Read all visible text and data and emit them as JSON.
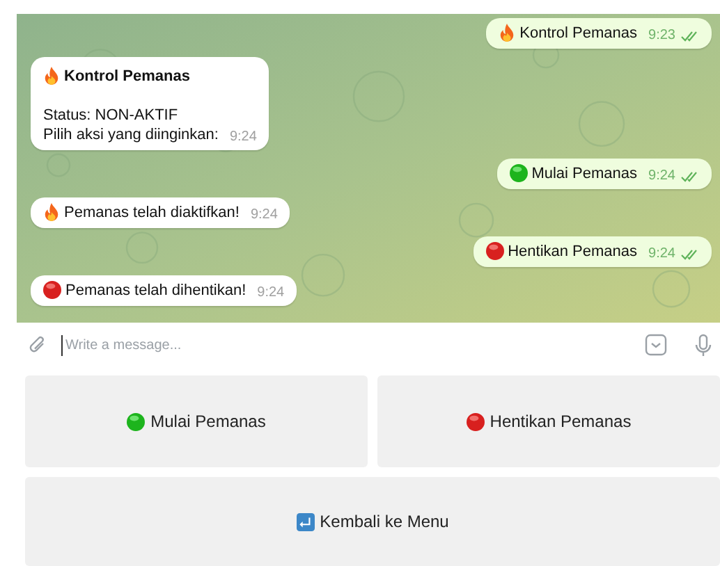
{
  "messages": [
    {
      "outgoing": true,
      "emoji": {
        "kind": "fire"
      },
      "lines": [
        "Kontrol Pemanas"
      ],
      "time": "9:23",
      "read": true
    },
    {
      "outgoing": false,
      "emoji": {
        "kind": "fire"
      },
      "title": "Kontrol Pemanas",
      "lines": [
        "Status: NON-AKTIF",
        "Pilih aksi yang diinginkan:"
      ],
      "time": "9:24"
    },
    {
      "outgoing": true,
      "emoji": {
        "kind": "go"
      },
      "lines": [
        "Mulai Pemanas"
      ],
      "time": "9:24",
      "read": true
    },
    {
      "outgoing": false,
      "emoji": {
        "kind": "fire"
      },
      "lines": [
        "Pemanas telah diaktifkan!"
      ],
      "time": "9:24"
    },
    {
      "outgoing": true,
      "emoji": {
        "kind": "stop"
      },
      "lines": [
        "Hentikan Pemanas"
      ],
      "time": "9:24",
      "read": true
    },
    {
      "outgoing": false,
      "emoji": {
        "kind": "stop"
      },
      "lines": [
        "Pemanas telah dihentikan!"
      ],
      "time": "9:24"
    }
  ],
  "composer": {
    "placeholder": "Write a message..."
  },
  "keyboard": [
    [
      {
        "label": "Mulai Pemanas",
        "emoji": {
          "kind": "go"
        }
      },
      {
        "label": "Hentikan Pemanas",
        "emoji": {
          "kind": "stop"
        }
      }
    ],
    [
      {
        "label": "Kembali ke Menu",
        "emoji": {
          "kind": "back"
        }
      }
    ]
  ]
}
